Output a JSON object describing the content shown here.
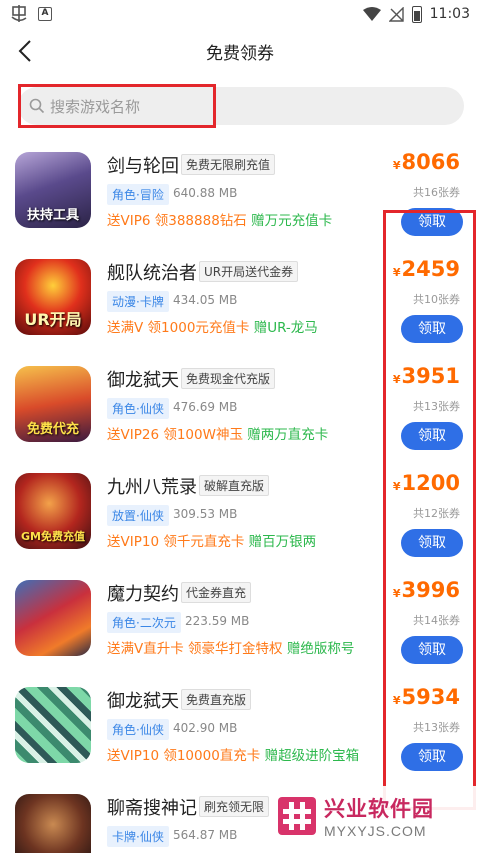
{
  "status_bar": {
    "time": "11:03",
    "app_icon_letter": "A"
  },
  "header": {
    "title": "免费领券",
    "back_icon": "chevron-left-icon"
  },
  "search": {
    "placeholder": "搜索游戏名称",
    "icon": "search-icon"
  },
  "colors": {
    "accent": "#2f6fe6",
    "price": "#ff6a00",
    "perk_orange": "#ff7a1a",
    "perk_green": "#2db84d",
    "highlight": "#e3262b"
  },
  "games": [
    {
      "name": "剑与轮回",
      "tag": "免费无限刷充值",
      "genre": "角色·冒险",
      "size": "640.88 MB",
      "perk1": "送VIP6",
      "perk2": "领388888钻石",
      "perk3": "赠万元充值卡",
      "currency": "¥",
      "price": "8066",
      "coupons": "共16张券",
      "button": "领取",
      "icon_caption": "扶持工具"
    },
    {
      "name": "舰队统治者",
      "tag": "UR开局送代金券",
      "genre": "动漫·卡牌",
      "size": "434.05 MB",
      "perk1": "送满V",
      "perk2": "领1000元充值卡",
      "perk3": "赠UR-龙马",
      "currency": "¥",
      "price": "2459",
      "coupons": "共10张券",
      "button": "领取",
      "icon_caption": "UR开局"
    },
    {
      "name": "御龙弑天",
      "tag": "免费现金代充版",
      "genre": "角色·仙侠",
      "size": "476.69 MB",
      "perk1": "送VIP26",
      "perk2": "领100W神玉",
      "perk3": "赠两万直充卡",
      "currency": "¥",
      "price": "3951",
      "coupons": "共13张券",
      "button": "领取",
      "icon_caption": "免费代充"
    },
    {
      "name": "九州八荒录",
      "tag": "破解直充版",
      "genre": "放置·仙侠",
      "size": "309.53 MB",
      "perk1": "送VIP10",
      "perk2": "领千元直充卡",
      "perk3": "赠百万银两",
      "currency": "¥",
      "price": "1200",
      "coupons": "共12张券",
      "button": "领取",
      "icon_caption": "GM免费充值"
    },
    {
      "name": "魔力契约",
      "tag": "代金券直充",
      "genre": "角色·二次元",
      "size": "223.59 MB",
      "perk1": "送满V直升卡",
      "perk2": "领豪华打金特权",
      "perk3": "赠绝版称号",
      "currency": "¥",
      "price": "3996",
      "coupons": "共14张券",
      "button": "领取",
      "icon_caption": ""
    },
    {
      "name": "御龙弑天",
      "tag": "免费直充版",
      "genre": "角色·仙侠",
      "size": "402.90 MB",
      "perk1": "送VIP10",
      "perk2": "领10000直充卡",
      "perk3": "赠超级进阶宝箱",
      "currency": "¥",
      "price": "5934",
      "coupons": "共13张券",
      "button": "领取",
      "icon_caption": ""
    },
    {
      "name": "聊斋搜神记",
      "tag": "刷充领无限",
      "genre": "卡牌·仙侠",
      "size": "564.87 MB",
      "perk1": "",
      "perk2": "",
      "perk3": "",
      "currency": "",
      "price": "",
      "coupons": "",
      "button": "",
      "icon_caption": ""
    }
  ],
  "watermark": {
    "cn": "兴业软件园",
    "en": "MYXYJS.COM"
  }
}
